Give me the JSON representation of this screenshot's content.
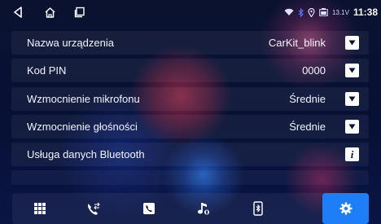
{
  "status_bar": {
    "nav": [
      "back-icon",
      "home-icon",
      "recent-apps-icon"
    ],
    "icons": [
      "wifi-icon",
      "bluetooth-icon",
      "location-icon",
      "battery-icon"
    ],
    "voltage": "13.1V",
    "clock": "11:38"
  },
  "settings": {
    "rows": [
      {
        "label": "Nazwa urządzenia",
        "value": "CarKit_blink",
        "control": "dropdown"
      },
      {
        "label": "Kod PIN",
        "value": "0000",
        "control": "dropdown"
      },
      {
        "label": "Wzmocnienie mikrofonu",
        "value": "Średnie",
        "control": "dropdown"
      },
      {
        "label": "Wzmocnienie głośności",
        "value": "Średnie",
        "control": "dropdown"
      },
      {
        "label": "Usługa danych Bluetooth",
        "value": "",
        "control": "info"
      }
    ],
    "info_glyph": "i"
  },
  "dock": {
    "items": [
      {
        "icon": "dialpad-icon",
        "active": false
      },
      {
        "icon": "call-log-icon",
        "active": false
      },
      {
        "icon": "contacts-icon",
        "active": false
      },
      {
        "icon": "bluetooth-music-icon",
        "active": false
      },
      {
        "icon": "bluetooth-device-icon",
        "active": false
      },
      {
        "icon": "settings-gear-icon",
        "active": true
      }
    ],
    "accent_color": "#1e7ef6"
  }
}
